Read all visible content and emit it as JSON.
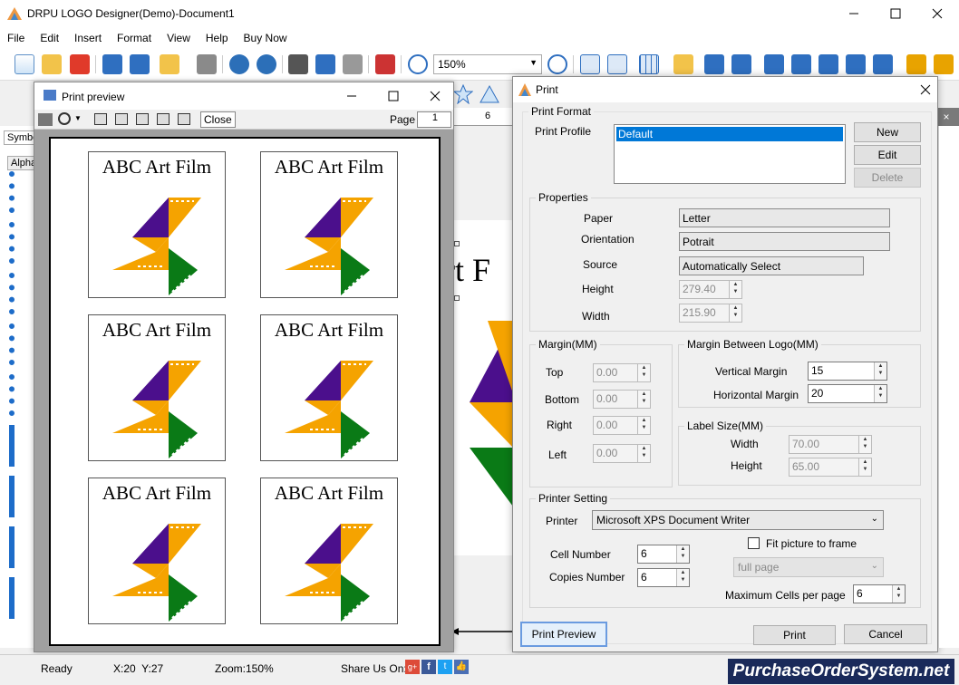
{
  "app": {
    "title": "DRPU LOGO Designer(Demo)-Document1",
    "menu": [
      "File",
      "Edit",
      "Insert",
      "Format",
      "View",
      "Help",
      "Buy Now"
    ],
    "zoom_value": "150%"
  },
  "status": {
    "ready": "Ready",
    "coords": "X:20  Y:27",
    "zoom": "Zoom:150%",
    "share": "Share Us On:",
    "brand": "PurchaseOrderSystem.net"
  },
  "canvas": {
    "partial_text": "rt F",
    "ruler_mark": "6"
  },
  "left_tabs": {
    "symbols": "Symbo",
    "alpha": "Alpha"
  },
  "preview": {
    "title": "Print preview",
    "close_label": "Close",
    "page_label": "Page",
    "page_value": "1",
    "logo_text": "ABC Art Film",
    "cells": 6
  },
  "print": {
    "title": "Print",
    "format_label": "Print Format",
    "profile_label": "Print Profile",
    "profile_selected": "Default",
    "new": "New",
    "edit": "Edit",
    "delete": "Delete",
    "properties_label": "Properties",
    "paper_label": "Paper",
    "paper_value": "Letter",
    "orientation_label": "Orientation",
    "orientation_value": "Potrait",
    "source_label": "Source",
    "source_value": "Automatically Select",
    "height_label": "Height",
    "height_value": "279.40",
    "width_label": "Width",
    "width_value": "215.90",
    "margin_label": "Margin(MM)",
    "top_label": "Top",
    "top_value": "0.00",
    "bottom_label": "Bottom",
    "bottom_value": "0.00",
    "right_label": "Right",
    "right_value": "0.00",
    "left_label": "Left",
    "left_value": "0.00",
    "between_label": "Margin Between Logo(MM)",
    "vertical_label": "Vertical Margin",
    "vertical_value": "15",
    "horizontal_label": "Horizontal Margin",
    "horizontal_value": "20",
    "labelsize_label": "Label Size(MM)",
    "ls_width_label": "Width",
    "ls_width_value": "70.00",
    "ls_height_label": "Height",
    "ls_height_value": "65.00",
    "printer_setting_label": "Printer Setting",
    "printer_label": "Printer",
    "printer_value": "Microsoft XPS Document Writer",
    "cell_label": "Cell Number",
    "cell_value": "6",
    "copies_label": "Copies Number",
    "copies_value": "6",
    "fit_label": "Fit picture to frame",
    "fit_mode": "full page",
    "max_cells_label": "Maximum Cells per page",
    "max_cells_value": "6",
    "preview_btn": "Print Preview",
    "print_btn": "Print",
    "cancel_btn": "Cancel"
  },
  "colors": {
    "purple": "#4b0f8c",
    "orange": "#f5a300",
    "green": "#0a7a16",
    "selection": "#0078d7",
    "brand_bg": "#1a2a5a"
  }
}
